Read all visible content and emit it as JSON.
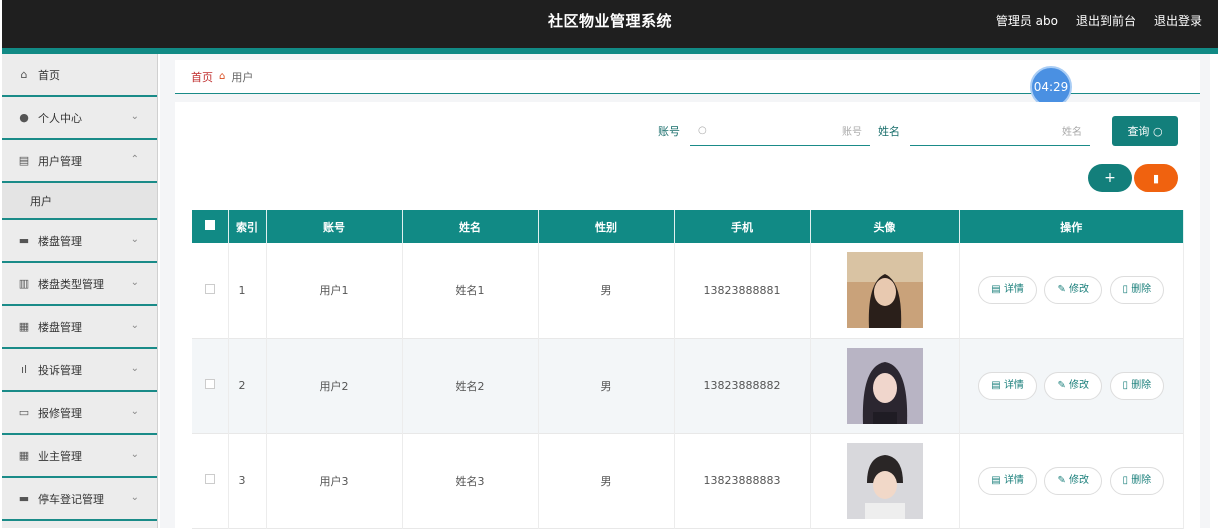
{
  "header": {
    "title": "社区物业管理系统",
    "user": "管理员 abo",
    "front_link": "退出到前台",
    "logout": "退出登录"
  },
  "sidebar": {
    "items": [
      {
        "label": "首页",
        "icon": "home-icon"
      },
      {
        "label": "个人中心",
        "icon": "person-icon"
      },
      {
        "label": "用户管理",
        "icon": "clipboard-icon"
      },
      {
        "label": "楼盘管理",
        "icon": "building-icon"
      },
      {
        "label": "楼盘类型管理",
        "icon": "bars-icon"
      },
      {
        "label": "楼盘管理",
        "icon": "clipboard-icon"
      },
      {
        "label": "投诉管理",
        "icon": "chart-icon"
      },
      {
        "label": "报修管理",
        "icon": "message-icon"
      },
      {
        "label": "业主管理",
        "icon": "grid-icon"
      },
      {
        "label": "停车登记管理",
        "icon": "card-icon"
      }
    ],
    "sub_item": "用户"
  },
  "breadcrumb": {
    "home": "首页",
    "current": "用户"
  },
  "timer": "04:29",
  "search": {
    "account_label": "账号",
    "account_placeholder": "账号",
    "name_label": "姓名",
    "name_placeholder": "姓名",
    "query_button": "查询"
  },
  "table": {
    "headers": [
      "索引",
      "账号",
      "姓名",
      "性别",
      "手机",
      "头像",
      "操作"
    ],
    "rows": [
      {
        "index": "1",
        "account": "用户1",
        "name": "姓名1",
        "gender": "男",
        "phone": "13823888881"
      },
      {
        "index": "2",
        "account": "用户2",
        "name": "姓名2",
        "gender": "男",
        "phone": "13823888882"
      },
      {
        "index": "3",
        "account": "用户3",
        "name": "姓名3",
        "gender": "男",
        "phone": "13823888883"
      }
    ],
    "actions": {
      "detail": "详情",
      "edit": "修改",
      "delete": "删除"
    }
  },
  "colors": {
    "accent": "#118a85",
    "danger": "#f0620f",
    "timer": "#4a90e2"
  }
}
